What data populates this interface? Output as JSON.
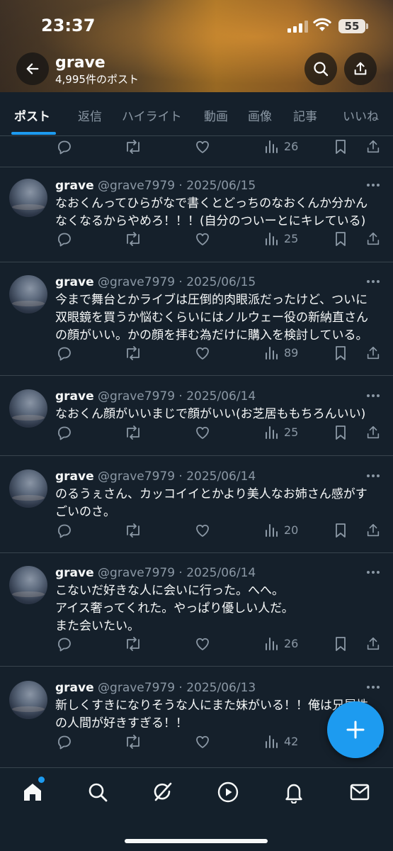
{
  "status": {
    "time": "23:37",
    "battery": "55"
  },
  "profile": {
    "name": "grave",
    "post_count": "4,995件のポスト"
  },
  "tabs": [
    "ポスト",
    "返信",
    "ハイライト",
    "動画",
    "画像",
    "記事",
    "いいね"
  ],
  "top_partial": {
    "views": "26"
  },
  "tweets": [
    {
      "name": "grave",
      "handle": "@grave7979 · 2025/06/15",
      "lines": [
        "なおくんってひらがなで書くとどっちのなおくんか分かん",
        "なくなるからやめろ！！！(自分のついーとにキレている)"
      ],
      "views": "25"
    },
    {
      "name": "grave",
      "handle": "@grave7979 · 2025/06/15",
      "lines": [
        "今まで舞台とかライブは圧倒的肉眼派だったけど、ついに",
        "双眼鏡を買うか悩むくらいにはノルウェー役の新納直さん",
        "の顔がいい。かの顔を拝む為だけに購入を検討している。"
      ],
      "views": "89"
    },
    {
      "name": "grave",
      "handle": "@grave7979 · 2025/06/14",
      "lines": [
        "なおくん顔がいいまじで顔がいい(お芝居ももちろんいい)"
      ],
      "views": "25"
    },
    {
      "name": "grave",
      "handle": "@grave7979 · 2025/06/14",
      "lines": [
        "のるうぇさん、カッコイイとかより美人なお姉さん感がす",
        "ごいのさ。"
      ],
      "views": "20"
    },
    {
      "name": "grave",
      "handle": "@grave7979 · 2025/06/14",
      "lines": [
        "こないだ好きな人に会いに行った。へへ。",
        "アイス奢ってくれた。やっぱり優しい人だ。",
        "また会いたい。"
      ],
      "views": "26"
    },
    {
      "name": "grave",
      "handle": "@grave7979 · 2025/06/13",
      "lines": [
        "新しくすきになりそうな人にまた妹がいる！！俺は兄属性",
        "の人間が好きすぎる！！"
      ],
      "views": "42"
    }
  ],
  "icons": {
    "back": "arrow-left-icon",
    "search": "search-icon",
    "share": "share-icon",
    "reply": "reply-icon",
    "repost": "repost-icon",
    "like": "heart-icon",
    "views": "views-bar-icon",
    "bookmark": "bookmark-icon",
    "compose": "plus-icon",
    "nav": [
      "home-icon",
      "search-icon",
      "grok-icon",
      "play-icon",
      "bell-icon",
      "mail-icon"
    ]
  },
  "colors": {
    "accent": "#1d9bf0",
    "background": "#15202b",
    "muted": "#8b98a5",
    "divider": "#38444d"
  }
}
